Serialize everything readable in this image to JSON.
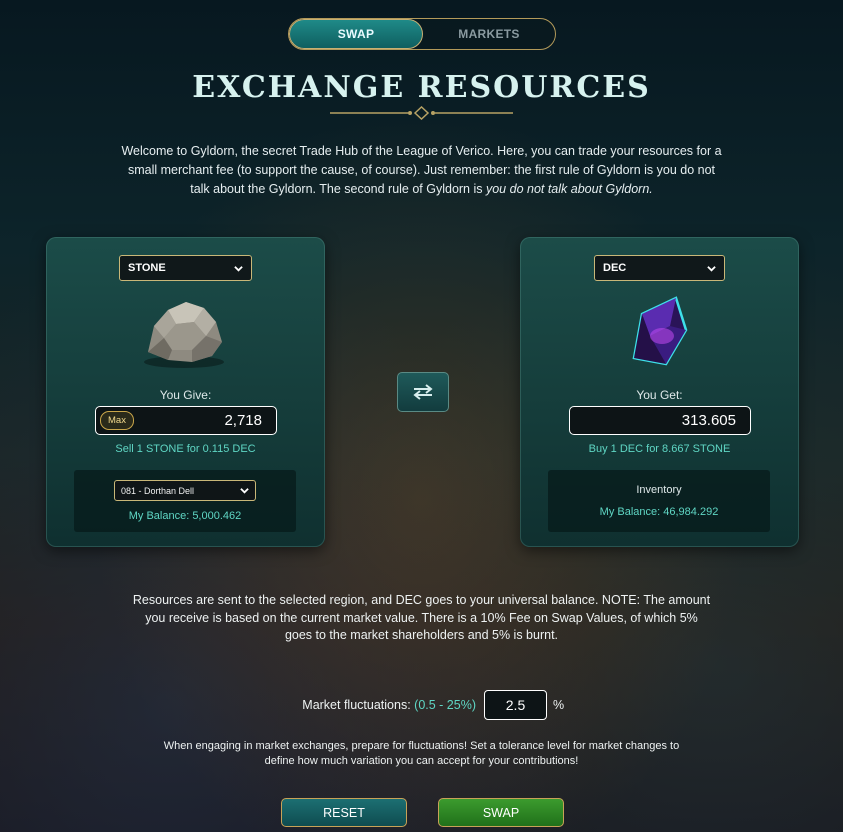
{
  "tabs": [
    {
      "label": "SWAP",
      "active": true
    },
    {
      "label": "MARKETS",
      "active": false
    }
  ],
  "page_title": "EXCHANGE RESOURCES",
  "intro": {
    "text": "Welcome to Gyldorn, the secret Trade Hub of the League of Verico. Here, you can trade your resources for a small merchant fee (to support the cause, of course). Just remember: the first rule of Gyldorn is you do not talk about the Gyldorn. The second rule of Gyldorn is ",
    "emphasis": "you do not talk about Gyldorn."
  },
  "give_card": {
    "resource_selected": "STONE",
    "label": "You Give:",
    "max_label": "Max",
    "amount": "2,718",
    "rate": "Sell 1 STONE for 0.115 DEC",
    "region_selected": "081 - Dorthan Dell",
    "balance": "My Balance: 5,000.462",
    "icon": "stone-resource-icon"
  },
  "get_card": {
    "resource_selected": "DEC",
    "label": "You Get:",
    "amount": "313.605",
    "rate": "Buy 1 DEC for 8.667 STONE",
    "inventory_title": "Inventory",
    "balance": "My Balance: 46,984.292",
    "icon": "dec-crystal-icon"
  },
  "note": "Resources are sent to the selected region, and DEC goes to your universal balance. NOTE: The amount you receive is based on the current market value. There is a 10% Fee on Swap Values, of which 5% goes to the market shareholders and 5% is burnt.",
  "fluctuation": {
    "label": "Market fluctuations:",
    "range": "(0.5 - 25%)",
    "value": "2.5",
    "unit": "%"
  },
  "tolerance_text": "When engaging in market exchanges, prepare for fluctuations! Set a tolerance level for market changes to define how much variation you can accept for your contributions!",
  "buttons": {
    "reset": "RESET",
    "swap": "SWAP"
  },
  "colors": {
    "accent_teal": "#5fd6c4",
    "gold_border": "#c9b778",
    "swap_green": "#3c9b2e"
  }
}
